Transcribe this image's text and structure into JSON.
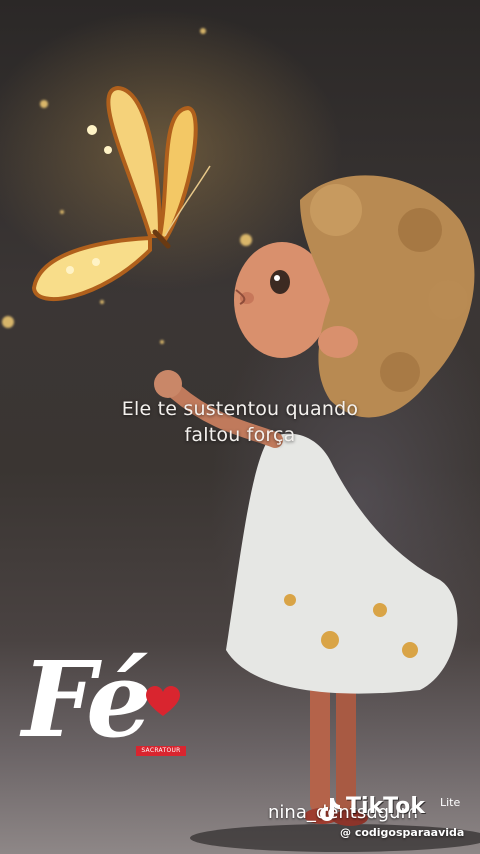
{
  "caption": {
    "line1": "Ele te sustentou quando",
    "line2": "faltou força"
  },
  "logo": {
    "word": "Fé",
    "tag": "SACRATOUR",
    "heart_color": "#d9252f"
  },
  "watermark": {
    "user_handle": "nina_dentsdgum",
    "app_name": "TikTok",
    "app_variant": "Lite",
    "channel_handle": "@ codigosparaavida",
    "icon": "tiktok-note-icon"
  },
  "colors": {
    "caption_text": "#f4f1ee",
    "butterfly_wing": "#f5d27a",
    "butterfly_edge": "#b0601c",
    "dress": "#e6e7e4",
    "hair": "#b88a52"
  }
}
